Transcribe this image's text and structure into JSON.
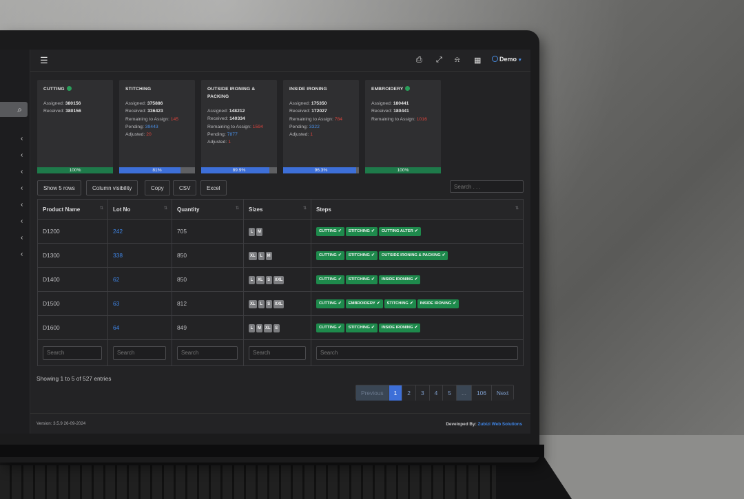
{
  "topbar": {
    "user_label": "Demo"
  },
  "cards": [
    {
      "title": "CUTTING",
      "lines": [
        [
          "Assigned:",
          "380156",
          ""
        ],
        [
          "Received:",
          "380156",
          ""
        ]
      ],
      "progress_pct": 100,
      "progress_label": "100%",
      "complete": true
    },
    {
      "title": "STITCHING",
      "lines": [
        [
          "Assigned:",
          "375886",
          ""
        ],
        [
          "Received:",
          "336423",
          ""
        ],
        [
          "Remaining to Assign:",
          "145",
          "red"
        ],
        [
          "Pending:",
          "39443",
          "blue"
        ],
        [
          "Adjusted:",
          "20",
          "red"
        ]
      ],
      "progress_pct": 81,
      "progress_label": "81%",
      "complete": false
    },
    {
      "title": "OUTSIDE IRONING & PACKING",
      "lines": [
        [
          "Assigned:",
          "148212",
          ""
        ],
        [
          "Received:",
          "140334",
          ""
        ],
        [
          "Remaining to Assign:",
          "1594",
          "red"
        ],
        [
          "Pending:",
          "7877",
          "blue"
        ],
        [
          "Adjusted:",
          "1",
          "red"
        ]
      ],
      "progress_pct": 89.9,
      "progress_label": "89.9%",
      "complete": false
    },
    {
      "title": "INSIDE IRONING",
      "lines": [
        [
          "Assigned:",
          "175350",
          ""
        ],
        [
          "Received:",
          "172027",
          ""
        ],
        [
          "Remaining to Assign:",
          "784",
          "red"
        ],
        [
          "Pending:",
          "3322",
          "blue"
        ],
        [
          "Adjusted:",
          "1",
          "red"
        ]
      ],
      "progress_pct": 96.3,
      "progress_label": "96.3%",
      "complete": false
    },
    {
      "title": "EMBROIDERY",
      "lines": [
        [
          "Assigned:",
          "180441",
          ""
        ],
        [
          "Received:",
          "180441",
          ""
        ],
        [
          "Remaining to Assign:",
          "1016",
          "red"
        ]
      ],
      "progress_pct": 100,
      "progress_label": "100%",
      "complete": true
    }
  ],
  "toolbar": {
    "show_rows": "Show 5 rows",
    "column_visibility": "Column visibility",
    "copy": "Copy",
    "csv": "CSV",
    "excel": "Excel",
    "search_placeholder": "Search . . ."
  },
  "table": {
    "headers": [
      "Product Name",
      "Lot No",
      "Quantity",
      "Sizes",
      "Steps"
    ],
    "rows": [
      {
        "product": "D1200",
        "lot": "242",
        "qty": "705",
        "sizes": [
          "L",
          "M"
        ],
        "steps": [
          "CUTTING",
          "STITCHING",
          "CUTTING ALTER"
        ]
      },
      {
        "product": "D1300",
        "lot": "338",
        "qty": "850",
        "sizes": [
          "XL",
          "L",
          "M"
        ],
        "steps": [
          "CUTTING",
          "STITCHING",
          "OUTSIDE IRONING & PACKING"
        ]
      },
      {
        "product": "D1400",
        "lot": "62",
        "qty": "850",
        "sizes": [
          "L",
          "XL",
          "S",
          "XXL"
        ],
        "steps": [
          "CUTTING",
          "STITCHING",
          "INSIDE IRONING"
        ]
      },
      {
        "product": "D1500",
        "lot": "63",
        "qty": "812",
        "sizes": [
          "XL",
          "L",
          "S",
          "XXL"
        ],
        "steps": [
          "CUTTING",
          "EMBROIDERY",
          "STITCHING",
          "INSIDE IRONING"
        ]
      },
      {
        "product": "D1600",
        "lot": "64",
        "qty": "849",
        "sizes": [
          "L",
          "M",
          "XL",
          "S"
        ],
        "steps": [
          "CUTTING",
          "STITCHING",
          "INSIDE IRONING"
        ]
      }
    ],
    "column_search_placeholder": "Search"
  },
  "info": "Showing 1 to 5 of 527 entries",
  "pagination": [
    "Previous",
    "1",
    "2",
    "3",
    "4",
    "5",
    "...",
    "106",
    "Next"
  ],
  "footer": {
    "version": "Version: 3.5.9 26-09-2024",
    "developed_by": "Developed By:",
    "company": "Zubizi Web Solutions"
  },
  "colors": {
    "accent_blue": "#3d6fd8",
    "step_green": "#1e8a4c",
    "danger_red": "#e0443c"
  }
}
